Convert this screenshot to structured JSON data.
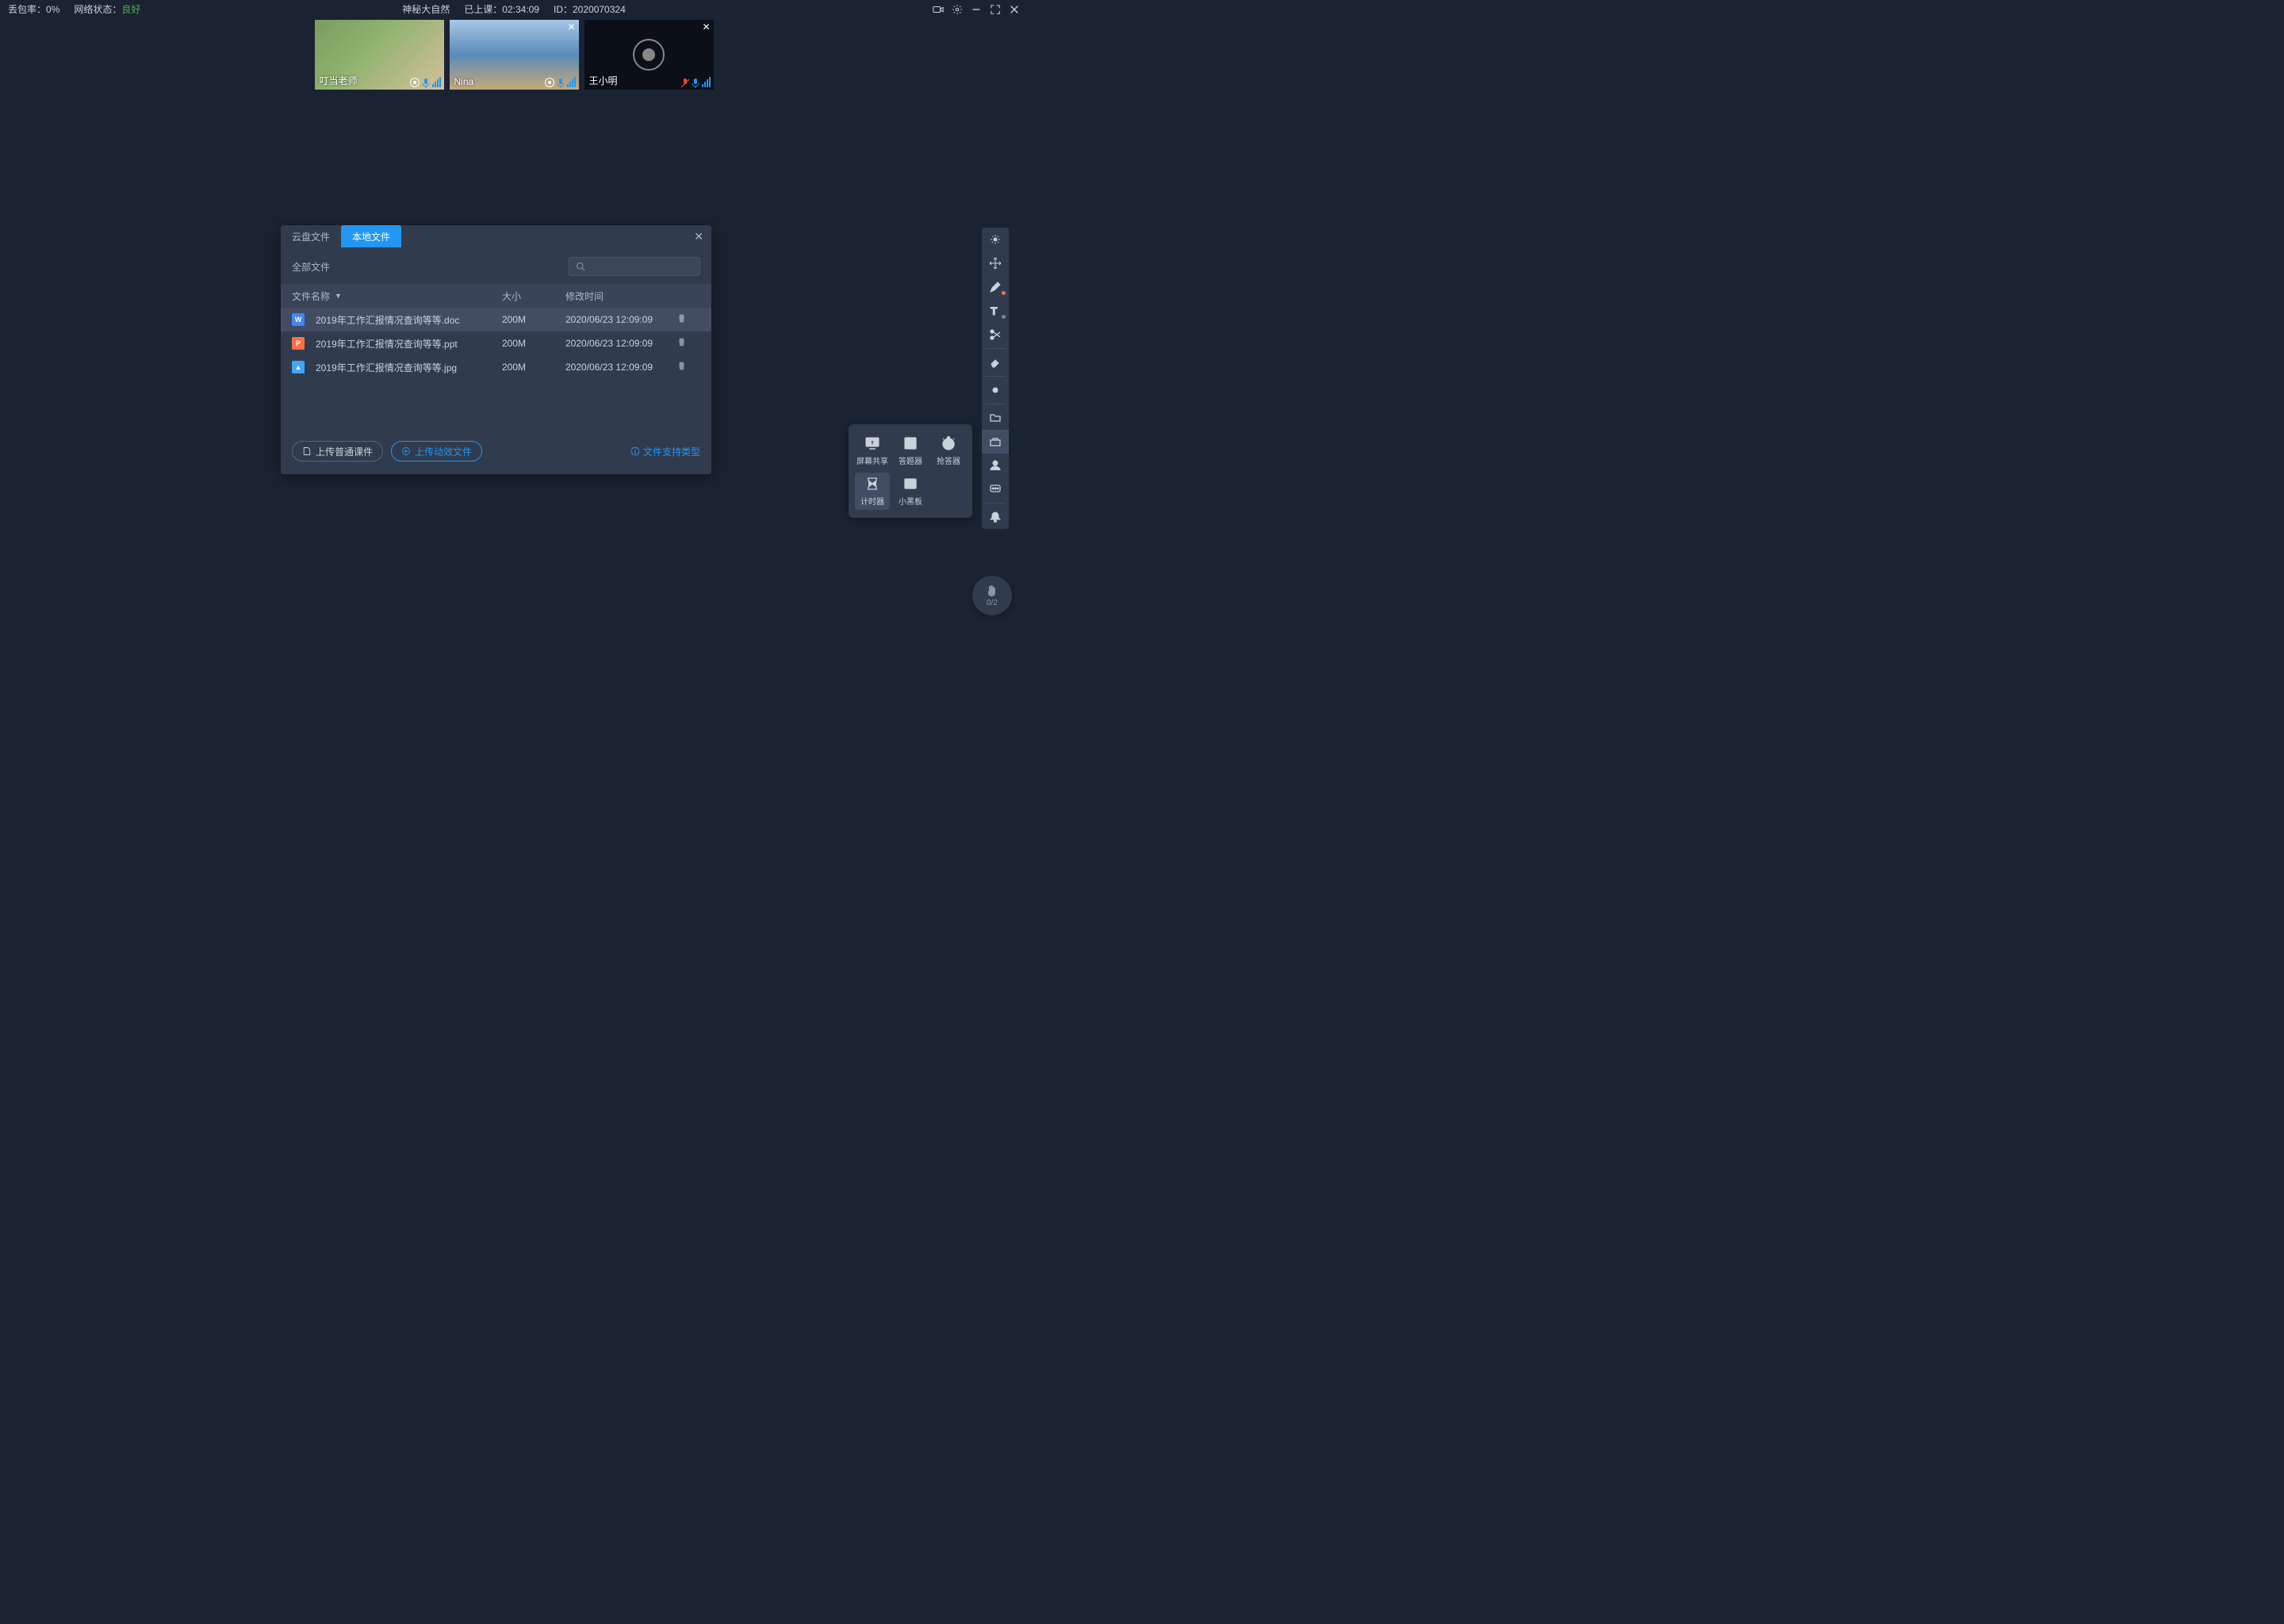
{
  "top": {
    "loss_label": "丢包率：",
    "loss_val": "0%",
    "net_label": "网络状态：",
    "net_val": "良好",
    "title": "神秘大自然",
    "elapsed_label": "已上课：",
    "elapsed_val": "02:34:09",
    "id_label": "ID：",
    "id_val": "2020070324"
  },
  "tiles": [
    {
      "name": "叮当老师",
      "cam": true,
      "mic": "on",
      "close": false
    },
    {
      "name": "Nina",
      "cam": true,
      "mic": "on",
      "close": true
    },
    {
      "name": "王小明",
      "cam": false,
      "mic": "off",
      "close": true
    }
  ],
  "dialog": {
    "tab_cloud": "云盘文件",
    "tab_local": "本地文件",
    "all_files": "全部文件",
    "cols": {
      "name": "文件名称",
      "size": "大小",
      "time": "修改时间"
    },
    "rows": [
      {
        "icon": "w",
        "name": "2019年工作汇报情况查询等等.doc",
        "size": "200M",
        "time": "2020/06/23 12:09:09"
      },
      {
        "icon": "p",
        "name": "2019年工作汇报情况查询等等.ppt",
        "size": "200M",
        "time": "2020/06/23 12:09:09"
      },
      {
        "icon": "i",
        "name": "2019年工作汇报情况查询等等.jpg",
        "size": "200M",
        "time": "2020/06/23 12:09:09"
      }
    ],
    "btn_upload_plain": "上传普通课件",
    "btn_upload_anim": "上传动效文件",
    "link_types": "文件支持类型"
  },
  "pop": {
    "screen_share": "屏幕共享",
    "quiz": "答题器",
    "buzzer": "抢答器",
    "timer": "计时器",
    "blackboard": "小黑板"
  },
  "hand": {
    "count": "0/2"
  }
}
